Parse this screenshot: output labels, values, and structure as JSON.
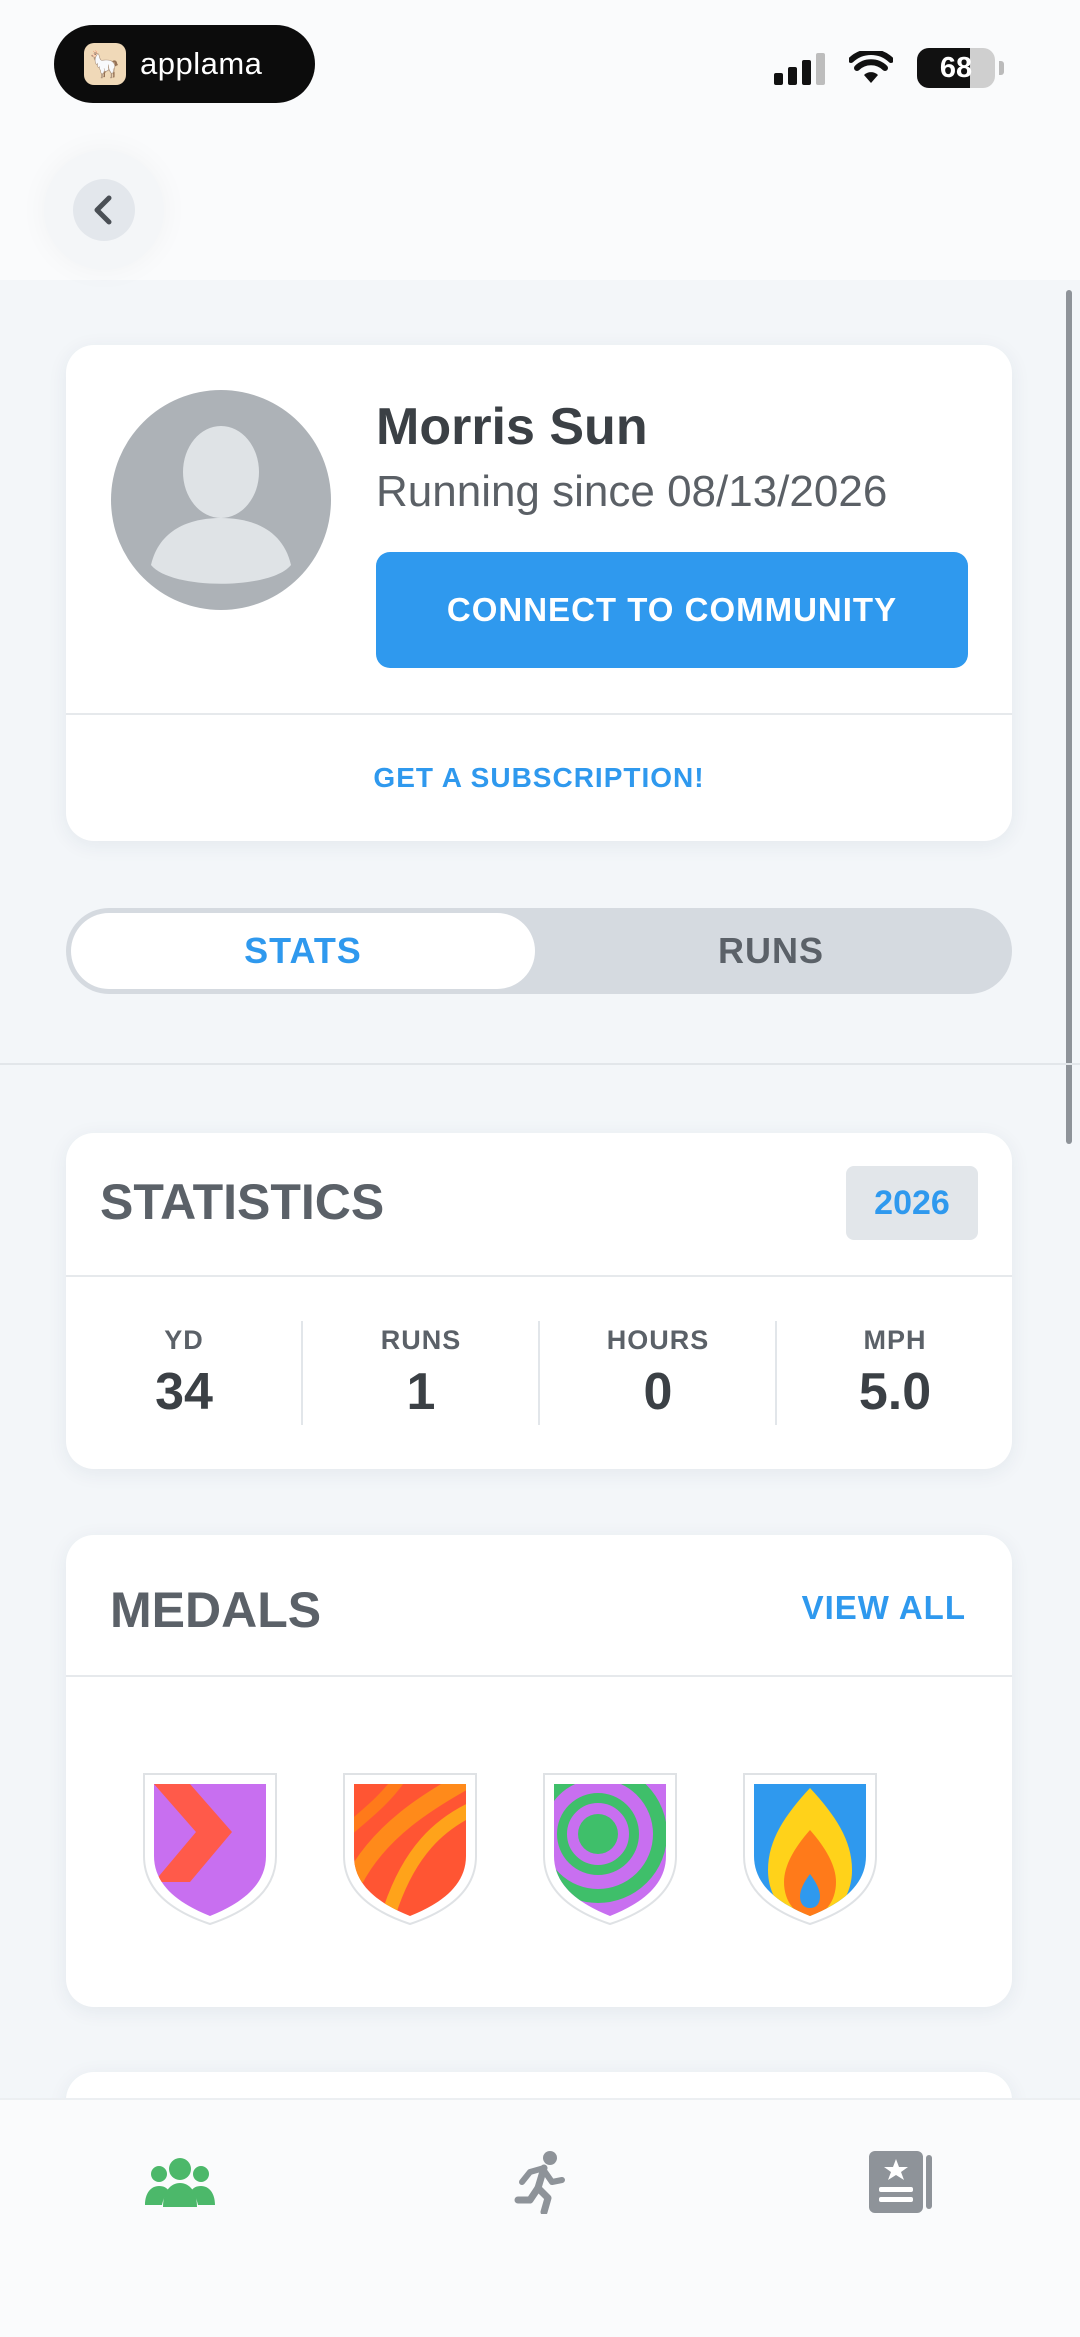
{
  "status_bar": {
    "app_badge": "applama",
    "battery_level": "68",
    "icons": [
      "llama-logo-icon",
      "signal-icon",
      "wifi-icon",
      "battery-icon"
    ]
  },
  "header": {
    "back_icon": "chevron-left-icon"
  },
  "profile": {
    "name": "Morris Sun",
    "running_since": "Running since 08/13/2026",
    "connect_label": "CONNECT TO COMMUNITY",
    "subscription_label": "GET A SUBSCRIPTION!"
  },
  "segmented": {
    "tabs": [
      {
        "label": "STATS",
        "active": true
      },
      {
        "label": "RUNS",
        "active": false
      }
    ]
  },
  "statistics": {
    "title": "STATISTICS",
    "year": "2026",
    "items": [
      {
        "label": "YD",
        "value": "34"
      },
      {
        "label": "RUNS",
        "value": "1"
      },
      {
        "label": "HOURS",
        "value": "0"
      },
      {
        "label": "MPH",
        "value": "5.0"
      }
    ]
  },
  "medals": {
    "title": "MEDALS",
    "view_all": "VIEW ALL",
    "items": [
      "chevron-shield-medal",
      "stripes-shield-medal",
      "target-shield-medal",
      "flame-shield-medal"
    ]
  },
  "tab_bar": {
    "items": [
      {
        "icon": "community-icon",
        "active": true
      },
      {
        "icon": "runner-icon",
        "active": false
      },
      {
        "icon": "journal-star-icon",
        "active": false
      }
    ]
  },
  "colors": {
    "accent": "#2f99ee",
    "active_tab": "#4cb86a",
    "inactive": "#8e9399"
  }
}
